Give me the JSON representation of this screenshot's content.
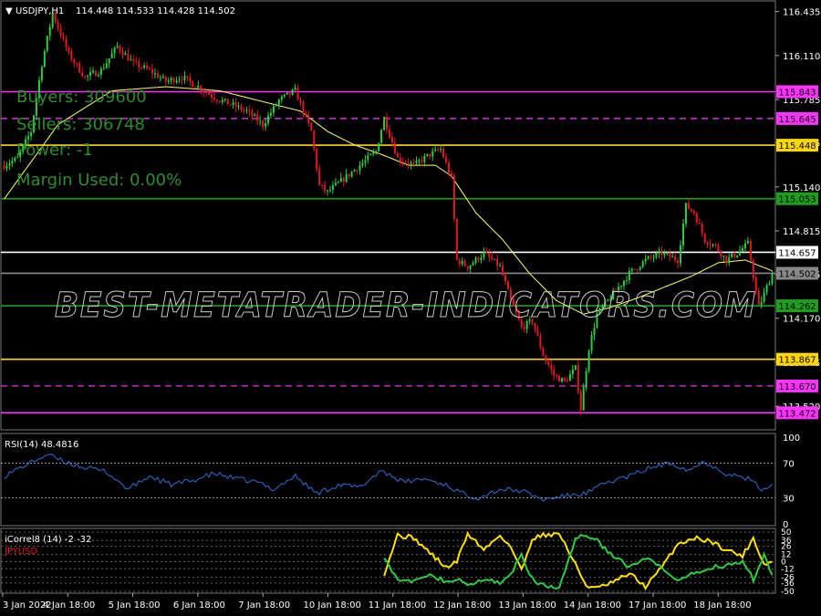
{
  "colors": {
    "background": "#000000",
    "bull": "#2ecc40",
    "bear": "#e0191f",
    "ma": "#ffff66",
    "rsi": "#2f6ed8",
    "correl_a": "#ffe100",
    "correl_b": "#2ecc40",
    "magenta": "#ff33ff",
    "yellow": "#ffd700",
    "green": "#1e9e1e",
    "white": "#ffffff"
  },
  "header": {
    "symbol": "USDJPY,H1",
    "ohlc": "114.448 114.533 114.428 114.502"
  },
  "info_panel": {
    "buyers": "Buyers: 309600",
    "sellers": "Sellers: 306748",
    "power": "Power: -1",
    "margin": "Margin Used: 0.00%"
  },
  "watermark": "BEST-METATRADER-INDICATORS.COM",
  "chart_data": [
    {
      "type": "candlestick",
      "title": "USDJPY,H1",
      "ylim": [
        113.4,
        116.5
      ],
      "y_ticks": [
        "116.435",
        "116.110",
        "115.785",
        "115.465",
        "115.140",
        "114.815",
        "114.495",
        "114.170",
        "113.845",
        "113.520"
      ],
      "x_ticks": [
        "3 Jan 2022",
        "4 Jan 18:00",
        "5 Jan 18:00",
        "6 Jan 18:00",
        "7 Jan 18:00",
        "10 Jan 18:00",
        "11 Jan 18:00",
        "12 Jan 18:00",
        "13 Jan 18:00",
        "14 Jan 18:00",
        "17 Jan 18:00",
        "18 Jan 18:00"
      ],
      "close_path": [
        [
          0,
          115.3
        ],
        [
          5,
          115.35
        ],
        [
          10,
          115.55
        ],
        [
          14,
          116.05
        ],
        [
          18,
          116.42
        ],
        [
          24,
          116.12
        ],
        [
          30,
          115.95
        ],
        [
          36,
          116.0
        ],
        [
          42,
          116.18
        ],
        [
          48,
          116.05
        ],
        [
          54,
          116.0
        ],
        [
          60,
          115.92
        ],
        [
          66,
          115.95
        ],
        [
          72,
          115.88
        ],
        [
          78,
          115.8
        ],
        [
          84,
          115.75
        ],
        [
          90,
          115.7
        ],
        [
          96,
          115.6
        ],
        [
          102,
          115.78
        ],
        [
          108,
          115.85
        ],
        [
          114,
          115.55
        ],
        [
          117,
          115.15
        ],
        [
          120,
          115.1
        ],
        [
          126,
          115.2
        ],
        [
          132,
          115.3
        ],
        [
          138,
          115.4
        ],
        [
          141,
          115.65
        ],
        [
          146,
          115.35
        ],
        [
          152,
          115.3
        ],
        [
          158,
          115.38
        ],
        [
          162,
          115.42
        ],
        [
          166,
          115.2
        ],
        [
          168,
          114.6
        ],
        [
          172,
          114.55
        ],
        [
          178,
          114.65
        ],
        [
          184,
          114.55
        ],
        [
          188,
          114.3
        ],
        [
          192,
          114.1
        ],
        [
          196,
          114.15
        ],
        [
          200,
          113.9
        ],
        [
          204,
          113.75
        ],
        [
          208,
          113.7
        ],
        [
          212,
          113.8
        ],
        [
          214,
          113.5
        ],
        [
          217,
          113.95
        ],
        [
          220,
          114.2
        ],
        [
          226,
          114.35
        ],
        [
          232,
          114.5
        ],
        [
          238,
          114.6
        ],
        [
          244,
          114.65
        ],
        [
          250,
          114.6
        ],
        [
          253,
          115.0
        ],
        [
          256,
          114.95
        ],
        [
          260,
          114.75
        ],
        [
          264,
          114.7
        ],
        [
          268,
          114.6
        ],
        [
          272,
          114.65
        ],
        [
          276,
          114.72
        ],
        [
          280,
          114.25
        ],
        [
          283,
          114.4
        ],
        [
          285,
          114.5
        ]
      ],
      "ma_path": [
        [
          0,
          115.05
        ],
        [
          20,
          115.6
        ],
        [
          40,
          115.85
        ],
        [
          60,
          115.88
        ],
        [
          80,
          115.85
        ],
        [
          100,
          115.75
        ],
        [
          110,
          115.7
        ],
        [
          120,
          115.55
        ],
        [
          130,
          115.45
        ],
        [
          140,
          115.38
        ],
        [
          150,
          115.3
        ],
        [
          160,
          115.3
        ],
        [
          166,
          115.22
        ],
        [
          175,
          114.95
        ],
        [
          185,
          114.75
        ],
        [
          195,
          114.5
        ],
        [
          205,
          114.3
        ],
        [
          215,
          114.2
        ],
        [
          225,
          114.25
        ],
        [
          235,
          114.32
        ],
        [
          245,
          114.4
        ],
        [
          255,
          114.48
        ],
        [
          265,
          114.58
        ],
        [
          275,
          114.6
        ],
        [
          285,
          114.52
        ]
      ],
      "levels": [
        {
          "value": 115.843,
          "label": "115.843",
          "color": "#ff33ff",
          "style": "solid"
        },
        {
          "value": 115.645,
          "label": "115.645",
          "color": "#ff33ff",
          "style": "dashed"
        },
        {
          "value": 115.448,
          "label": "115.448",
          "color": "#ffd700",
          "style": "solid"
        },
        {
          "value": 115.053,
          "label": "115.053",
          "color": "#1e9e1e",
          "style": "solid"
        },
        {
          "value": 114.657,
          "label": "114.657",
          "color": "#ffffff",
          "style": "solid"
        },
        {
          "value": 114.502,
          "label": "114.502",
          "color": "#888888",
          "style": "solid"
        },
        {
          "value": 114.262,
          "label": "114.262",
          "color": "#1e9e1e",
          "style": "solid"
        },
        {
          "value": 113.867,
          "label": "113.867",
          "color": "#ffd700",
          "style": "solid"
        },
        {
          "value": 113.67,
          "label": "113.670",
          "color": "#ff33ff",
          "style": "dashed"
        },
        {
          "value": 113.472,
          "label": "113.472",
          "color": "#ff33ff",
          "style": "solid"
        }
      ]
    },
    {
      "type": "line",
      "title": "RSI(14) 48.4816",
      "ylim": [
        0,
        100
      ],
      "y_ticks": [
        100,
        70,
        30,
        0
      ],
      "levels": [
        70,
        30
      ],
      "series": [
        {
          "name": "RSI(14)",
          "x": [
            0,
            8,
            16,
            22,
            30,
            38,
            46,
            54,
            62,
            70,
            78,
            86,
            94,
            100,
            108,
            116,
            124,
            132,
            140,
            148,
            156,
            164,
            170,
            176,
            184,
            192,
            200,
            208,
            216,
            224,
            232,
            240,
            248,
            254,
            260,
            268,
            276,
            282,
            285
          ],
          "values": [
            55,
            68,
            80,
            72,
            65,
            60,
            40,
            55,
            45,
            50,
            58,
            52,
            48,
            40,
            55,
            35,
            45,
            42,
            62,
            48,
            52,
            45,
            35,
            30,
            40,
            38,
            28,
            32,
            35,
            48,
            55,
            65,
            70,
            62,
            72,
            58,
            52,
            38,
            48
          ]
        }
      ]
    },
    {
      "type": "line",
      "title": "iCorrel8 (14) -2 -32",
      "ylim": [
        -50,
        50
      ],
      "y_ticks": [
        "50",
        "36",
        "26",
        "12",
        "0",
        "-12",
        "-26",
        "-36",
        "-50"
      ],
      "series": [
        {
          "name": "JPYUSD",
          "x": [
            141,
            146,
            152,
            158,
            164,
            168,
            172,
            178,
            184,
            188,
            192,
            196,
            200,
            206,
            212,
            216,
            220,
            226,
            232,
            238,
            244,
            250,
            256,
            262,
            268,
            274,
            278,
            282,
            285
          ],
          "values": [
            -20,
            45,
            40,
            15,
            -10,
            0,
            48,
            20,
            45,
            25,
            -15,
            40,
            45,
            48,
            -5,
            -40,
            -45,
            -35,
            -20,
            -42,
            -10,
            30,
            40,
            35,
            20,
            10,
            40,
            -5,
            0
          ],
          "color": "#ffe100"
        },
        {
          "name": "iCorrel8",
          "x": [
            141,
            146,
            152,
            158,
            164,
            168,
            172,
            178,
            184,
            188,
            192,
            196,
            200,
            206,
            212,
            216,
            220,
            226,
            232,
            238,
            244,
            250,
            256,
            262,
            268,
            274,
            278,
            282,
            285
          ],
          "values": [
            10,
            -30,
            -35,
            -20,
            -35,
            -30,
            -40,
            -30,
            -35,
            -20,
            10,
            -30,
            -40,
            -45,
            40,
            45,
            35,
            10,
            -10,
            5,
            -10,
            -35,
            -20,
            -10,
            -5,
            0,
            -30,
            10,
            -20
          ],
          "color": "#2ecc40"
        }
      ]
    }
  ],
  "panels": {
    "rsi_label": "RSI(14) 48.4816",
    "correl_label": "iCorrel8 (14) -2 -32",
    "correl_symbol": "JPYUSD"
  }
}
